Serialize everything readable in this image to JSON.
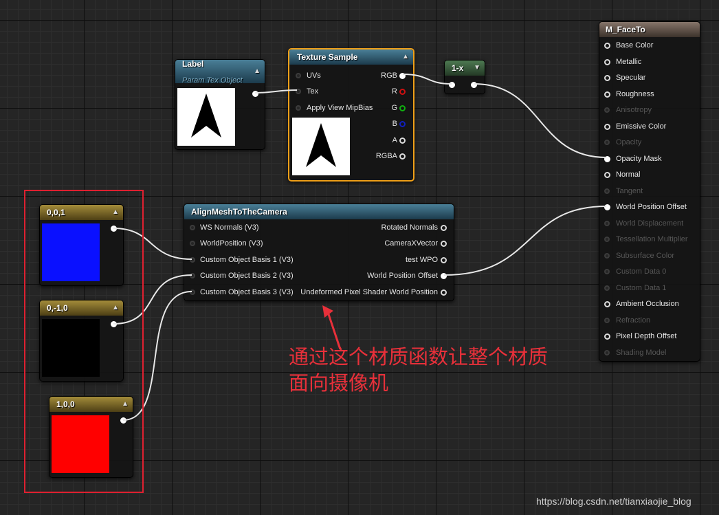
{
  "nodes": {
    "label": {
      "title": "Label",
      "subtitle": "Param Tex Object"
    },
    "texture_sample": {
      "title": "Texture Sample",
      "inputs": [
        "UVs",
        "Tex",
        "Apply View MipBias"
      ],
      "outputs": [
        "RGB",
        "R",
        "G",
        "B",
        "A",
        "RGBA"
      ]
    },
    "one_minus": {
      "title": "1-x"
    },
    "c001": {
      "title": "0,0,1",
      "swatch_color": "#0a10ff"
    },
    "c0m10": {
      "title": "0,-1,0",
      "swatch_color": "#000000"
    },
    "c100": {
      "title": "1,0,0",
      "swatch_color": "#ff0000"
    },
    "align": {
      "title": "AlignMeshToTheCamera",
      "inputs": [
        "WS Normals (V3)",
        "WorldPosition (V3)",
        "Custom Object Basis 1 (V3)",
        "Custom Object Basis 2 (V3)",
        "Custom Object Basis 3 (V3)"
      ],
      "outputs": [
        "Rotated Normals",
        "CameraXVector",
        "test WPO",
        "World Position Offset",
        "Undeformed Pixel Shader World Position"
      ]
    },
    "material": {
      "title": "M_FaceTo",
      "pins": [
        {
          "label": "Base Color",
          "active": true
        },
        {
          "label": "Metallic",
          "active": true
        },
        {
          "label": "Specular",
          "active": true
        },
        {
          "label": "Roughness",
          "active": true
        },
        {
          "label": "Anisotropy",
          "active": false
        },
        {
          "label": "Emissive Color",
          "active": true
        },
        {
          "label": "Opacity",
          "active": false
        },
        {
          "label": "Opacity Mask",
          "active": true
        },
        {
          "label": "Normal",
          "active": true
        },
        {
          "label": "Tangent",
          "active": false
        },
        {
          "label": "World Position Offset",
          "active": true
        },
        {
          "label": "World Displacement",
          "active": false
        },
        {
          "label": "Tessellation Multiplier",
          "active": false
        },
        {
          "label": "Subsurface Color",
          "active": false
        },
        {
          "label": "Custom Data 0",
          "active": false
        },
        {
          "label": "Custom Data 1",
          "active": false
        },
        {
          "label": "Ambient Occlusion",
          "active": true
        },
        {
          "label": "Refraction",
          "active": false
        },
        {
          "label": "Pixel Depth Offset",
          "active": true
        },
        {
          "label": "Shading Model",
          "active": false
        }
      ]
    }
  },
  "annotation": {
    "line1": "通过这个材质函数让整个材质",
    "line2": "面向摄像机"
  },
  "watermark": "https://blog.csdn.net/tianxiaojie_blog"
}
